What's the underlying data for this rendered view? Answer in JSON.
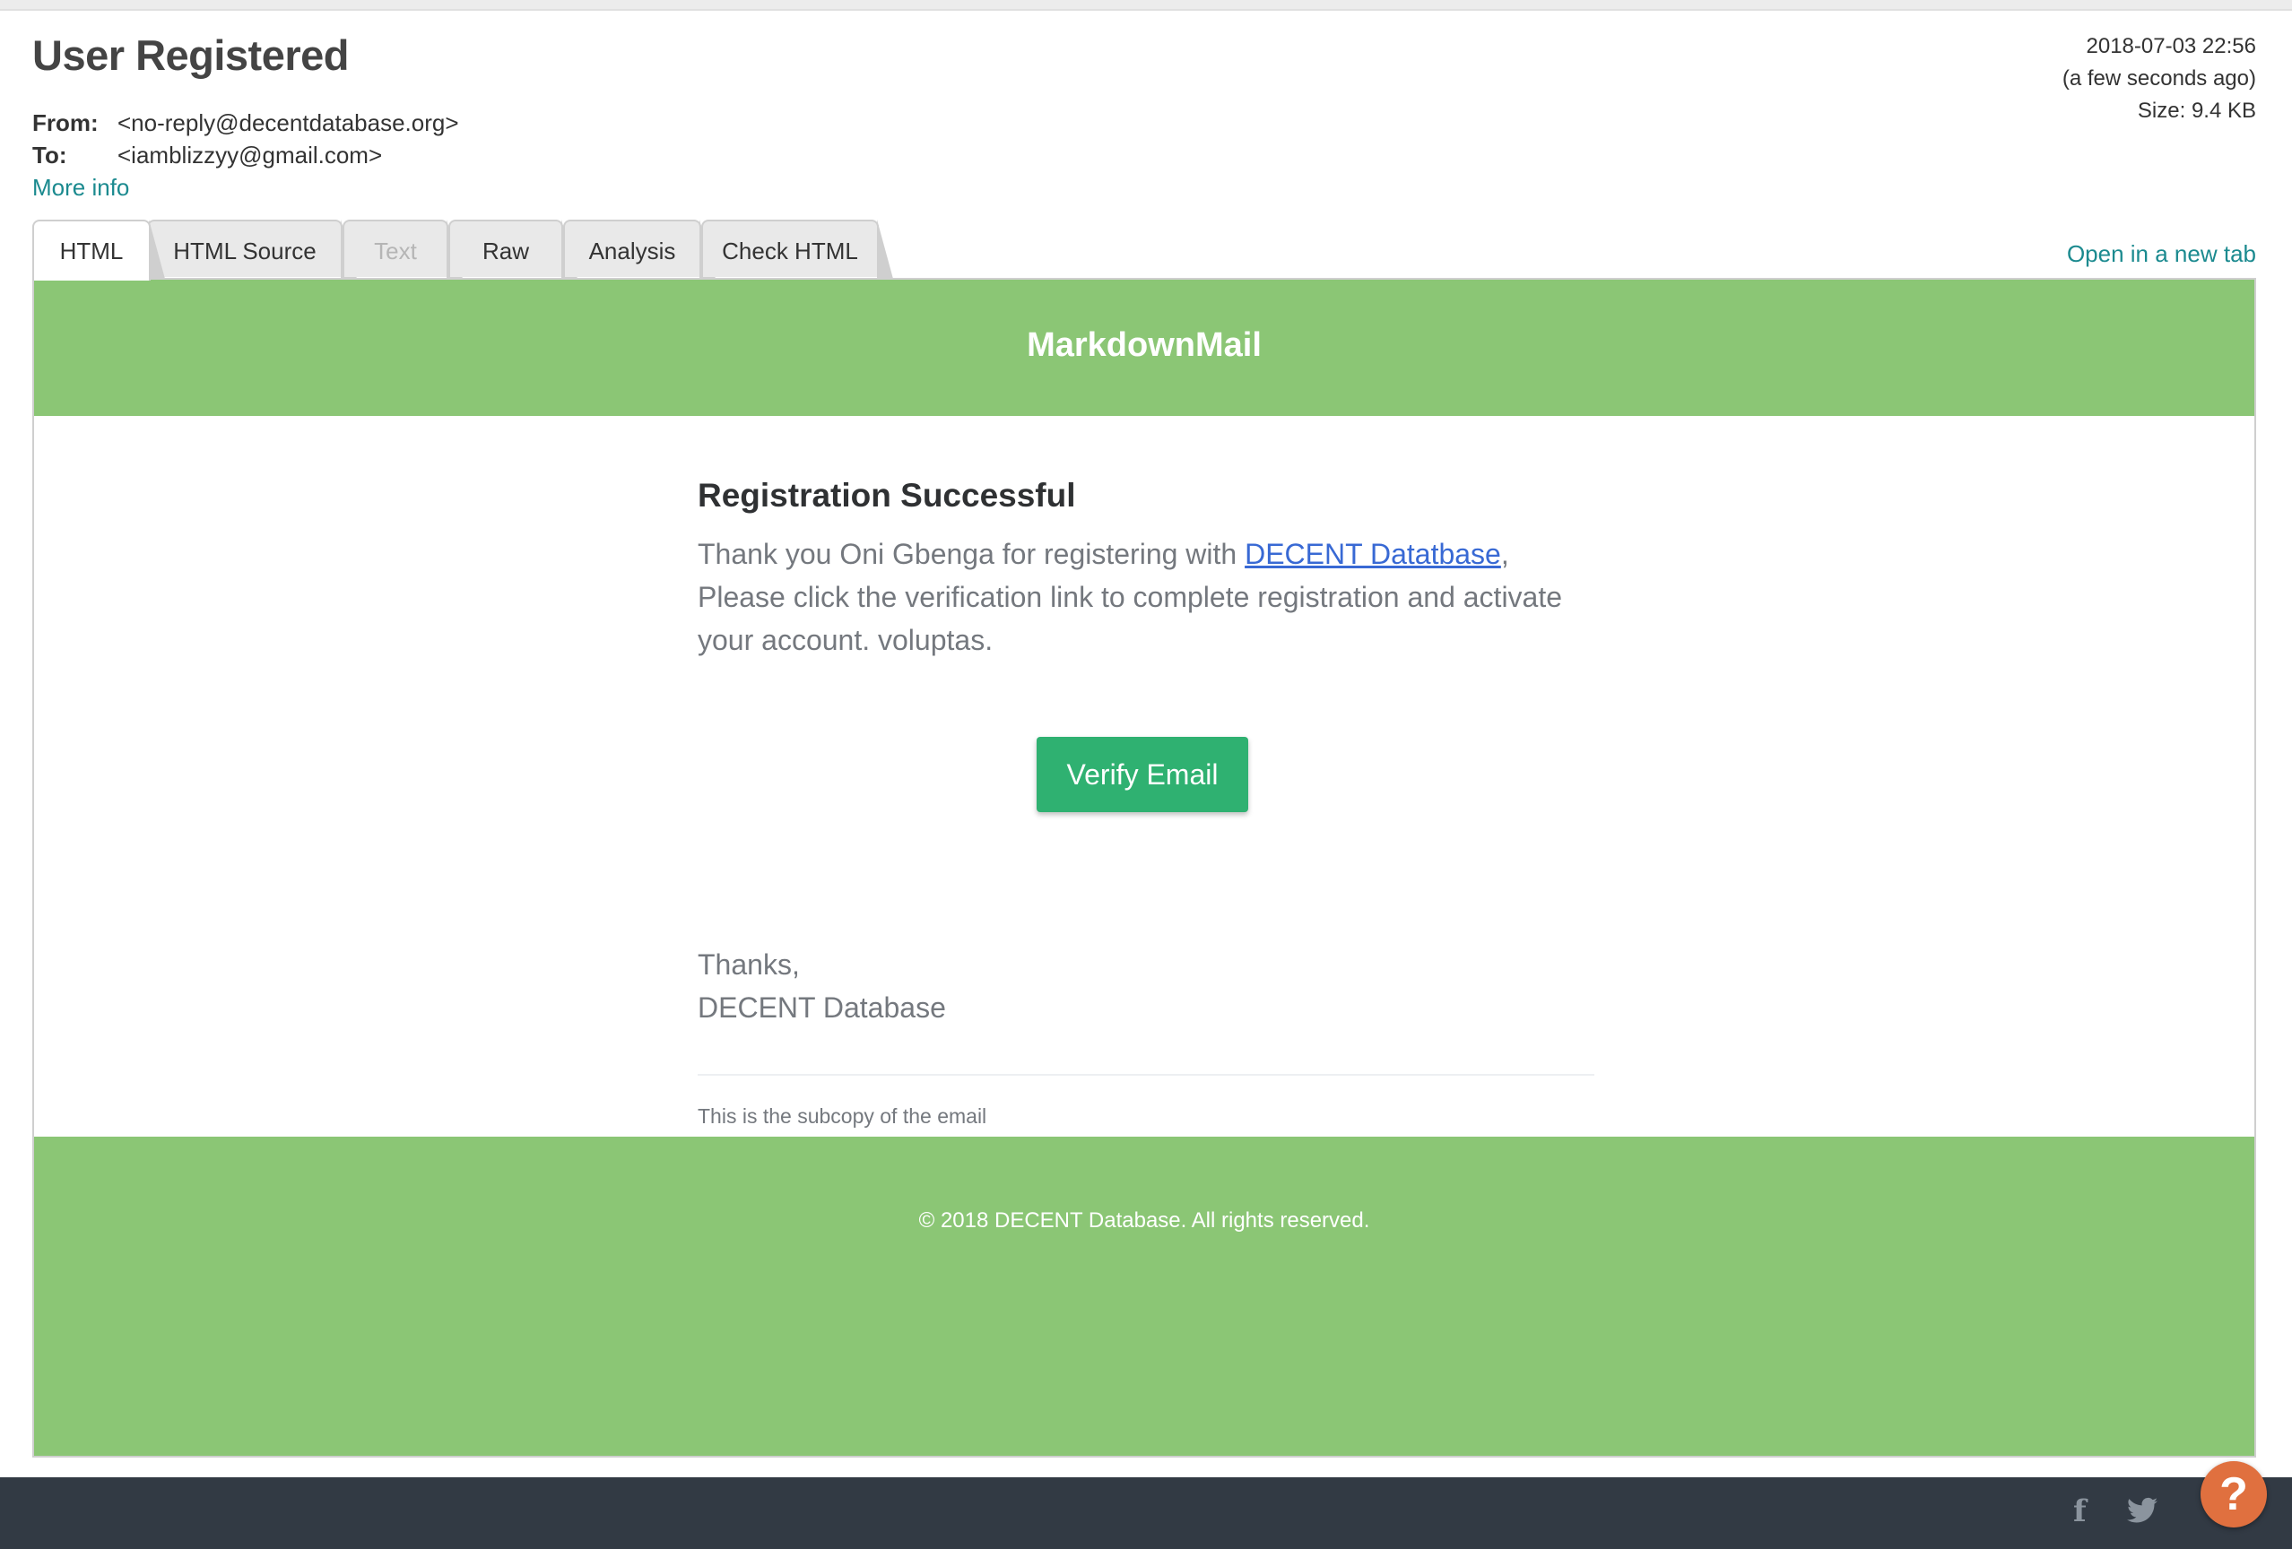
{
  "message": {
    "subject": "User Registered",
    "from_label": "From:",
    "from_value": "<no-reply@decentdatabase.org>",
    "to_label": "To:",
    "to_value": "<iamblizzyy@gmail.com>",
    "more_info": "More info",
    "date": "2018-07-03 22:56",
    "relative_time": "(a few seconds ago)",
    "size": "Size: 9.4 KB"
  },
  "tabs": [
    {
      "label": "HTML",
      "state": "active"
    },
    {
      "label": "HTML Source",
      "state": "normal"
    },
    {
      "label": "Text",
      "state": "disabled"
    },
    {
      "label": "Raw",
      "state": "normal"
    },
    {
      "label": "Analysis",
      "state": "normal"
    },
    {
      "label": "Check HTML",
      "state": "normal"
    }
  ],
  "open_new_tab": "Open in a new tab",
  "email": {
    "brand": "MarkdownMail",
    "heading": "Registration Successful",
    "para_prefix": "Thank you Oni Gbenga for registering with ",
    "para_link": "DECENT Datatbase",
    "para_suffix": ", Please click the verification link to complete registration and activate your account. voluptas.",
    "button": "Verify Email",
    "thanks_line1": "Thanks,",
    "thanks_line2": "DECENT Database",
    "subcopy": "This is the subcopy of the email",
    "copyright": "© 2018 DECENT Database. All rights reserved."
  },
  "footer": {
    "facebook_icon": "f",
    "twitter_icon": "🐦",
    "help_icon": "?"
  },
  "colors": {
    "email_green": "#8bc675",
    "button_green": "#2fb171",
    "link_teal": "#1b8a8f",
    "link_blue": "#3869d4",
    "bottom_bar": "#323a44",
    "help_orange": "#e0703f"
  }
}
